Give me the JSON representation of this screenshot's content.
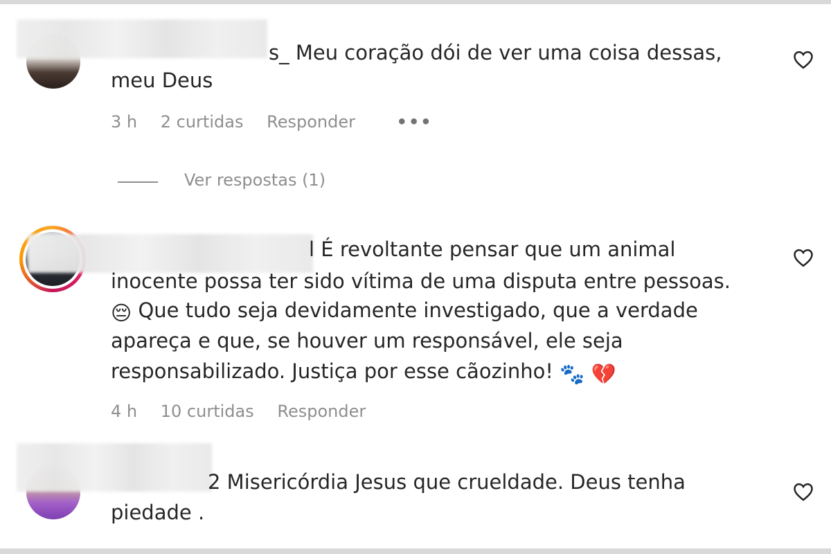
{
  "comments": [
    {
      "text_line1": "s_ Meu coração dói de ver uma coisa dessas,",
      "text_line2": "meu Deus",
      "time": "3 h",
      "likes": "2 curtidas",
      "reply": "Responder",
      "more": "•••",
      "view_replies": "Ver respostas (1)"
    },
    {
      "text_line1": "l É revoltante pensar que um animal",
      "text_line2": "inocente possa ter sido vítima de uma disputa entre pessoas.",
      "text_line3": " Que tudo seja devidamente investigado, que a verdade",
      "text_line4": "apareça e que, se houver um responsável, ele seja",
      "text_line5": "responsabilizado. Justiça por esse cãozinho! ",
      "emoji_sad": "😔",
      "emoji_paws": "🐾",
      "emoji_heart": "💔",
      "time": "4 h",
      "likes": "10 curtidas",
      "reply": "Responder"
    },
    {
      "text_line1": "2 Misericórdia Jesus que crueldade. Deus tenha",
      "text_line2": "piedade ."
    }
  ]
}
